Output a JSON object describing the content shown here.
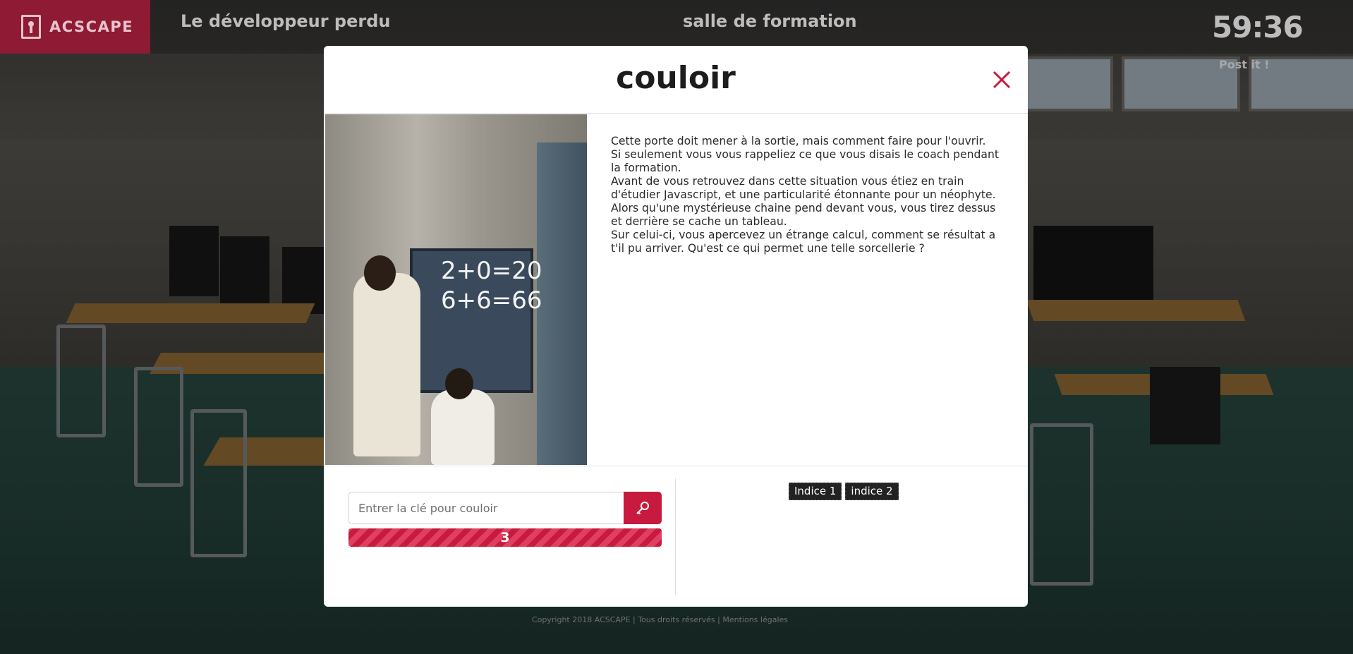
{
  "header": {
    "brand": "ACSCAPE",
    "game_title": "Le développeur perdu",
    "room_title": "salle de formation",
    "timer": "59:36",
    "postit_label": "Post it !"
  },
  "footer": {
    "text": "Copyright 2018 ACSCAPE | Tous droits réservés | Mentions légales"
  },
  "modal": {
    "title": "couloir",
    "description": [
      "Cette porte doit mener à la sortie, mais comment faire pour l'ouvrir.",
      "Si seulement vous vous rappeliez ce que vous disais le coach pendant la formation.",
      "Avant de vous retrouvez dans cette situation vous étiez en train d'étudier Javascript, et une particularité étonnante pour un néophyte.",
      "Alors qu'une mystérieuse chaine pend devant vous, vous tirez dessus et derrière se cache un tableau.",
      "Sur celui-ci, vous apercevez un étrange calcul, comment se résultat a t'il pu arriver. Qu'est ce qui permet une telle sorcellerie ?"
    ],
    "image": {
      "chalk_line_1": "2+0=20",
      "chalk_line_2": "6+6=66"
    },
    "key_input": {
      "placeholder": "Entrer la clé pour couloir",
      "value": ""
    },
    "attempts_left": "3",
    "hints": [
      "Indice 1",
      "indice 2"
    ]
  },
  "icons": {
    "close": "close-icon",
    "key": "key-icon",
    "brand": "keyhole-icon"
  },
  "colors": {
    "accent": "#c8193e",
    "brand_bg": "#8e1a33"
  }
}
